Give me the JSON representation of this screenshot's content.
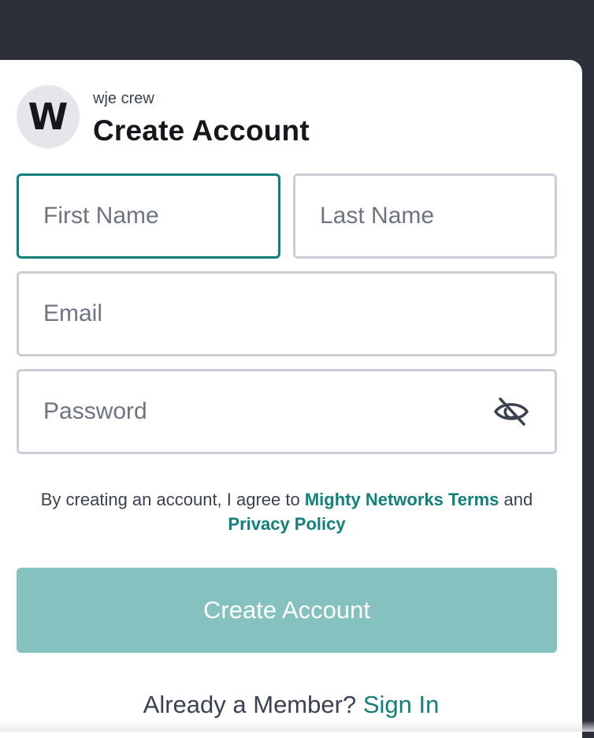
{
  "community": {
    "initial": "W",
    "name": "wje crew"
  },
  "title": "Create Account",
  "fields": {
    "first_name": {
      "placeholder": "First Name",
      "value": ""
    },
    "last_name": {
      "placeholder": "Last Name",
      "value": ""
    },
    "email": {
      "placeholder": "Email",
      "value": ""
    },
    "password": {
      "placeholder": "Password",
      "value": ""
    }
  },
  "password_toggle_icon": "eye-slash-icon",
  "terms": {
    "prefix": "By creating an account, I agree to",
    "terms_link": "Mighty Networks Terms",
    "conjunction": "and",
    "privacy_link": "Privacy Policy"
  },
  "submit_label": "Create Account",
  "signin": {
    "prompt": "Already a Member?",
    "link": "Sign In"
  },
  "colors": {
    "accent": "#11807a",
    "button_disabled": "#84c1bf",
    "backdrop": "#2d303a",
    "field_border": "#cbced6"
  }
}
